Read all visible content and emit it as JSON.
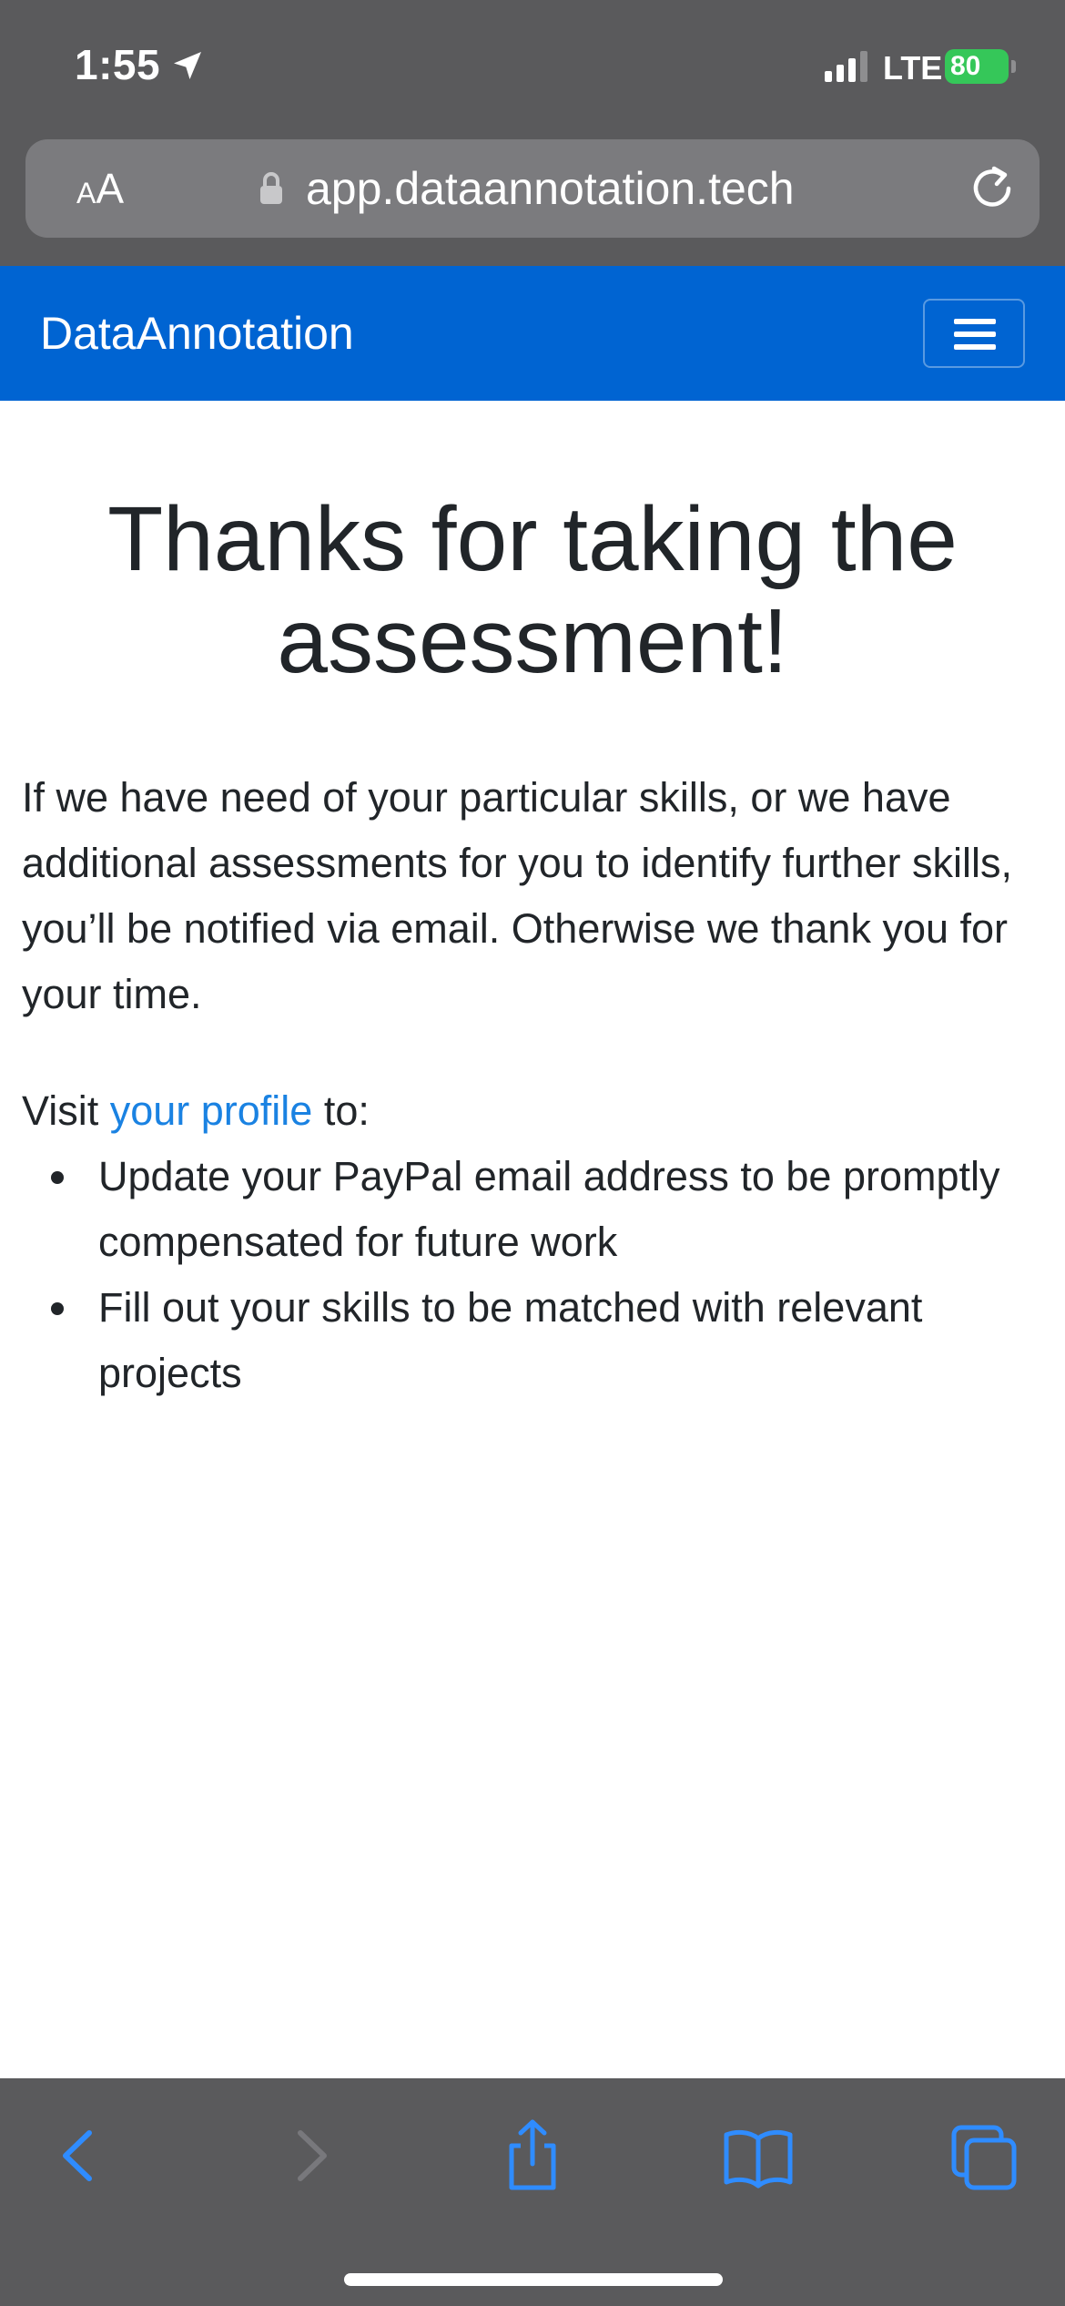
{
  "status_bar": {
    "time": "1:55",
    "carrier": "LTE",
    "battery": "80"
  },
  "address_bar": {
    "text_size_label_small": "A",
    "text_size_label_large": "A",
    "url": "app.dataannotation.tech"
  },
  "navbar": {
    "brand": "DataAnnotation",
    "background_color": "#0064d2"
  },
  "main": {
    "title": "Thanks for taking the assessment!",
    "message": "If we have need of your particular skills, or we have additional assessments for you to identify further skills, you’ll be notified via email. Otherwise we thank you for your time.",
    "visit_prefix": "Visit ",
    "profile_link": "your profile",
    "visit_suffix": " to:",
    "items": [
      "Update your PayPal email address to be promptly compensated for future work",
      "Fill out your skills to be matched with relevant projects"
    ],
    "link_color": "#1a82e2"
  },
  "toolbar": {
    "icons": [
      "back-icon",
      "forward-icon",
      "share-icon",
      "bookmarks-icon",
      "tabs-icon"
    ]
  }
}
